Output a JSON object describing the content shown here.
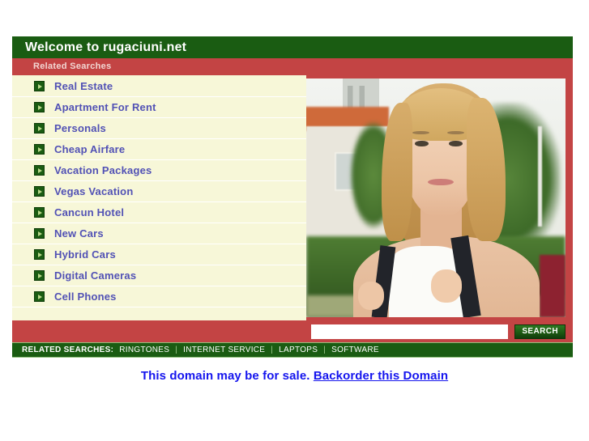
{
  "header": {
    "title": "Welcome to rugaciuni.net"
  },
  "related_searches_bar": {
    "label": "Related Searches"
  },
  "links": [
    {
      "label": "Real Estate",
      "icon": "arrow-right-icon"
    },
    {
      "label": "Apartment For Rent",
      "icon": "arrow-right-icon"
    },
    {
      "label": "Personals",
      "icon": "arrow-right-icon"
    },
    {
      "label": "Cheap Airfare",
      "icon": "arrow-right-icon"
    },
    {
      "label": "Vacation Packages",
      "icon": "arrow-right-icon"
    },
    {
      "label": "Vegas Vacation",
      "icon": "arrow-right-icon"
    },
    {
      "label": "Cancun Hotel",
      "icon": "arrow-right-icon"
    },
    {
      "label": "New Cars",
      "icon": "arrow-right-icon"
    },
    {
      "label": "Hybrid Cars",
      "icon": "arrow-right-icon"
    },
    {
      "label": "Digital Cameras",
      "icon": "arrow-right-icon"
    },
    {
      "label": "Cell Phones",
      "icon": "arrow-right-icon"
    }
  ],
  "search": {
    "value": "",
    "placeholder": "",
    "button_label": "SEARCH"
  },
  "footer": {
    "label": "RELATED SEARCHES:",
    "items": [
      {
        "label": "RINGTONES"
      },
      {
        "label": "INTERNET SERVICE"
      },
      {
        "label": "LAPTOPS"
      },
      {
        "label": "SOFTWARE"
      }
    ],
    "separator": "|"
  },
  "notice": {
    "text": "This domain may be for sale.",
    "link_label": "Backorder this Domain"
  },
  "colors": {
    "green": "#1a5c12",
    "red": "#c34444",
    "cream": "#f7f7d8",
    "link_blue": "#5151b5",
    "notice_blue": "#1515ee"
  }
}
